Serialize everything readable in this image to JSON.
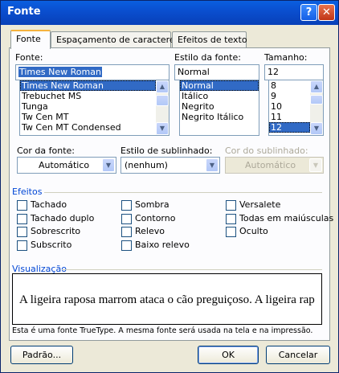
{
  "window": {
    "title": "Fonte"
  },
  "tabs": [
    {
      "label": "Fonte"
    },
    {
      "label": "Espaçamento de caracteres"
    },
    {
      "label": "Efeitos de texto"
    }
  ],
  "font": {
    "label": "Fonte:",
    "value": "Times New Roman",
    "items": [
      "Times New Roman",
      "Trebuchet MS",
      "Tunga",
      "Tw Cen MT",
      "Tw Cen MT Condensed"
    ],
    "selected_index": 0
  },
  "style": {
    "label": "Estilo da fonte:",
    "value": "Normal",
    "items": [
      "Normal",
      "Itálico",
      "Negrito",
      "Negrito Itálico"
    ],
    "selected_index": 0
  },
  "size": {
    "label": "Tamanho:",
    "value": "12",
    "items": [
      "8",
      "9",
      "10",
      "11",
      "12"
    ],
    "selected_index": 4
  },
  "font_color": {
    "label": "Cor da fonte:",
    "value": "Automático"
  },
  "underline_style": {
    "label": "Estilo de sublinhado:",
    "value": "(nenhum)"
  },
  "underline_color": {
    "label": "Cor do sublinhado:",
    "value": "Automático",
    "enabled": false
  },
  "effects": {
    "title": "Efeitos",
    "col1": [
      "Tachado",
      "Tachado duplo",
      "Sobrescrito",
      "Subscrito"
    ],
    "col2": [
      "Sombra",
      "Contorno",
      "Relevo",
      "Baixo relevo"
    ],
    "col3": [
      "Versalete",
      "Todas em maiúsculas",
      "Oculto"
    ],
    "checked": []
  },
  "preview": {
    "title": "Visualização",
    "text": "A ligeira raposa marrom ataca o cão preguiçoso.  A ligeira rap"
  },
  "note": "Esta é uma fonte TrueType. A mesma fonte será usada na tela e na impressão.",
  "buttons": {
    "default": "Padrão...",
    "ok": "OK",
    "cancel": "Cancelar"
  },
  "colors": {
    "accent": "#0046d5",
    "selection": "#316ac5",
    "titlebar": "#0a4fd0"
  }
}
